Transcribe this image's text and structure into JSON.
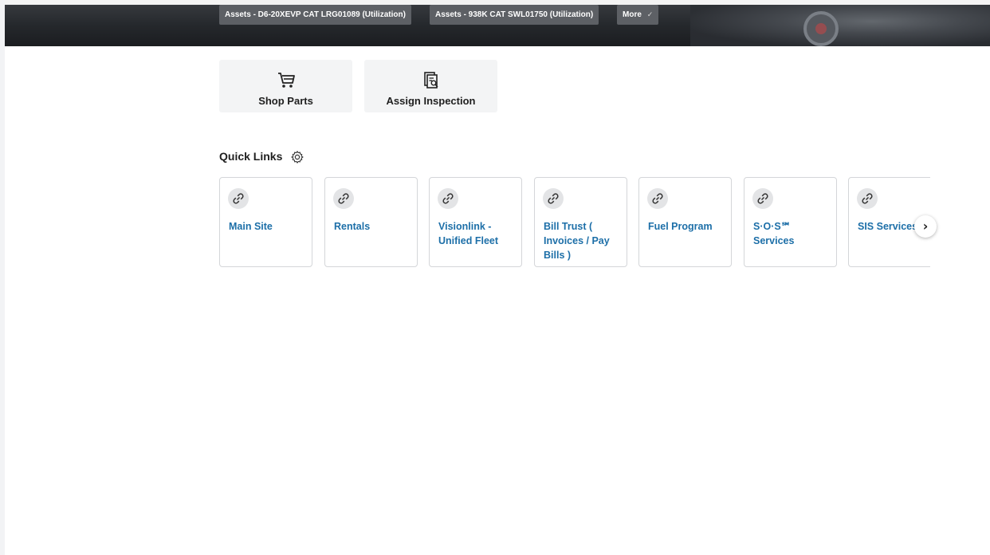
{
  "hero": {
    "asset_chips": [
      {
        "label": "Assets - D6-20XEVP CAT LRG01089 (Utilization)"
      },
      {
        "label": "Assets - 938K CAT SWL01750 (Utilization)"
      }
    ],
    "more_label": "More",
    "more_icon": "chevron-down-icon"
  },
  "actions": [
    {
      "label": "Shop Parts",
      "icon": "shopping-cart-icon"
    },
    {
      "label": "Assign Inspection",
      "icon": "inspection-document-icon"
    }
  ],
  "quick_links": {
    "title": "Quick Links",
    "settings_icon": "gear-icon",
    "items": [
      {
        "label": "Main Site",
        "icon": "link-icon"
      },
      {
        "label": "Rentals",
        "icon": "link-icon"
      },
      {
        "label": "Visionlink - Unified Fleet",
        "icon": "link-icon"
      },
      {
        "label": "Bill Trust ( Invoices / Pay Bills )",
        "icon": "link-icon"
      },
      {
        "label": "Fuel Program",
        "icon": "link-icon"
      },
      {
        "label": "S·O·S℠ Services",
        "icon": "link-icon"
      },
      {
        "label": "SIS Services",
        "icon": "link-icon"
      }
    ],
    "next_icon": "chevron-right-icon",
    "link_color": "#1d6fa8"
  }
}
